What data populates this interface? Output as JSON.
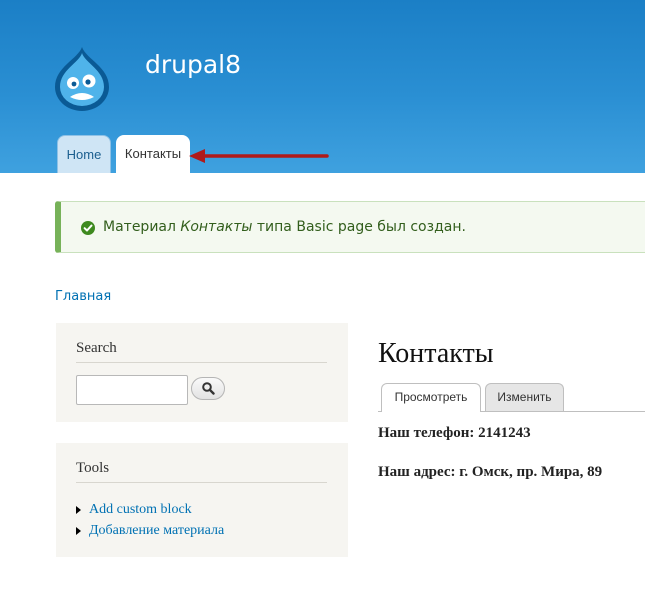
{
  "header": {
    "site_name": "drupal8",
    "nav": [
      {
        "label": "Home"
      },
      {
        "label": "Контакты"
      }
    ]
  },
  "status_message": {
    "prefix": "Материал ",
    "node_title": "Контакты",
    "suffix": " типа Basic page был создан."
  },
  "breadcrumb": {
    "home": "Главная"
  },
  "sidebar": {
    "search": {
      "title": "Search",
      "input_value": "",
      "button_icon": "search-icon"
    },
    "tools": {
      "title": "Tools",
      "items": [
        {
          "label": "Add custom block"
        },
        {
          "label": "Добавление материала"
        }
      ]
    }
  },
  "main": {
    "title": "Контакты",
    "tabs": [
      {
        "label": "Просмотреть"
      },
      {
        "label": "Изменить"
      }
    ],
    "body": [
      "Наш телефон: 2141243",
      "Наш адрес: г. Омск, пр. Мира, 89"
    ]
  },
  "colors": {
    "header_blue": "#2a8fd3",
    "link": "#0071b3",
    "status_green": "#77b259",
    "annotation_arrow": "#b01a1a"
  }
}
